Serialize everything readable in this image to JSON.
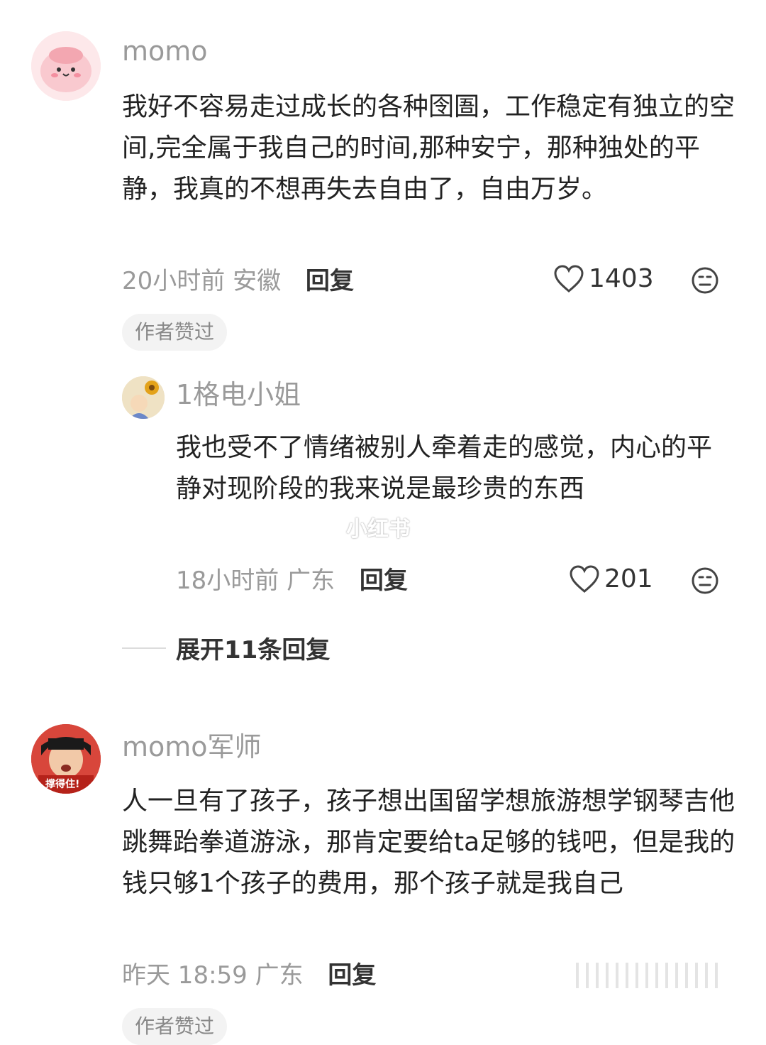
{
  "comments": [
    {
      "username": "momo",
      "text": "我好不容易走过成长的各种囹圄，工作稳定有独立的空间,完全属于我自己的时间,那种安宁，那种独处的平静，我真的不想再失去自由了，自由万岁。",
      "meta": "20小时前 安徽",
      "reply_label": "回复",
      "likes": "1403",
      "badge": "作者赞过"
    },
    {
      "username": "momo军师",
      "avatar_text": "撑得住!",
      "text": "人一旦有了孩子，孩子想出国留学想旅游想学钢琴吉他跳舞跆拳道游泳，那肯定要给ta足够的钱吧，但是我的钱只够1个孩子的费用，那个孩子就是我自己",
      "meta": "昨天 18:59 广东",
      "reply_label": "回复",
      "badge": "作者赞过"
    }
  ],
  "reply": {
    "username": "1格电小姐",
    "text": "我也受不了情绪被别人牵着走的感觉，内心的平静对现阶段的我来说是最珍贵的东西",
    "meta": "18小时前 广东",
    "reply_label": "回复",
    "likes": "201"
  },
  "expand_label": "展开11条回复",
  "watermark": "小红书",
  "icons": {
    "like": "heart-outline-icon",
    "dislike": "neutral-face-icon"
  },
  "colors": {
    "text": "#222222",
    "meta": "#9a9a9a",
    "badge_bg": "#f3f3f3"
  }
}
